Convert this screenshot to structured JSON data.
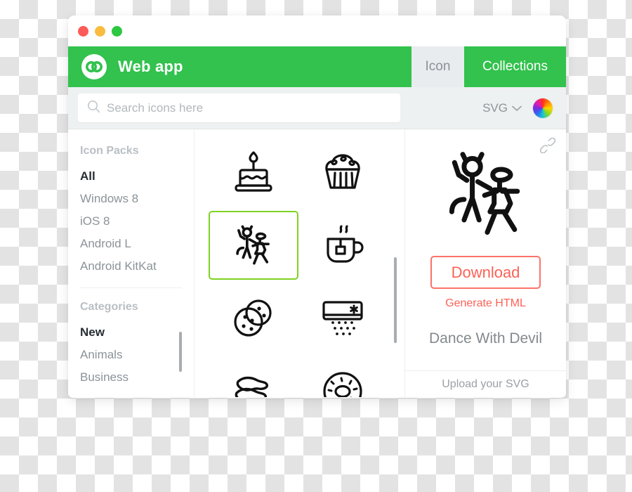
{
  "window": {
    "traffic_lights": [
      {
        "name": "close",
        "color": "#fc5b57"
      },
      {
        "name": "minimize",
        "color": "#f9bc3f"
      },
      {
        "name": "zoom",
        "color": "#2ec742"
      }
    ]
  },
  "header": {
    "brand_title": "Web app",
    "brand_color": "#32c24d",
    "logo_icon": "infinity-logo-icon",
    "tabs": [
      {
        "label": "Icon",
        "active": false
      },
      {
        "label": "Collections",
        "active": true
      }
    ]
  },
  "search": {
    "placeholder": "Search icons here",
    "value": "",
    "icon": "search-icon",
    "format_value": "SVG",
    "format_caret": "chevron-down-icon",
    "color_picker": "color-wheel-icon"
  },
  "sidebar": {
    "groups": [
      {
        "title": "Icon Packs",
        "items": [
          {
            "label": "All",
            "selected": true
          },
          {
            "label": "Windows 8",
            "selected": false
          },
          {
            "label": "iOS 8",
            "selected": false
          },
          {
            "label": "Android L",
            "selected": false
          },
          {
            "label": "Android KitKat",
            "selected": false
          }
        ]
      },
      {
        "title": "Categories",
        "items": [
          {
            "label": "New",
            "selected": true
          },
          {
            "label": "Animals",
            "selected": false
          },
          {
            "label": "Business",
            "selected": false
          }
        ]
      }
    ]
  },
  "grid": {
    "selection_color": "#7ed321",
    "icons": [
      {
        "name": "birthday-cake-icon",
        "selected": false
      },
      {
        "name": "muffin-icon",
        "selected": false
      },
      {
        "name": "dance-with-devil-icon",
        "selected": true
      },
      {
        "name": "tea-cup-icon",
        "selected": false
      },
      {
        "name": "cookies-icon",
        "selected": false
      },
      {
        "name": "air-conditioner-icon",
        "selected": false
      },
      {
        "name": "bacon-icon",
        "selected": false
      },
      {
        "name": "donut-icon",
        "selected": false
      }
    ]
  },
  "detail": {
    "link_icon": "chain-link-icon",
    "preview_icon": "dance-with-devil-icon",
    "download_label": "Download",
    "generate_label": "Generate HTML",
    "icon_name": "Dance With Devil",
    "upload_label": "Upload your SVG",
    "accent_color": "#fc6257"
  }
}
